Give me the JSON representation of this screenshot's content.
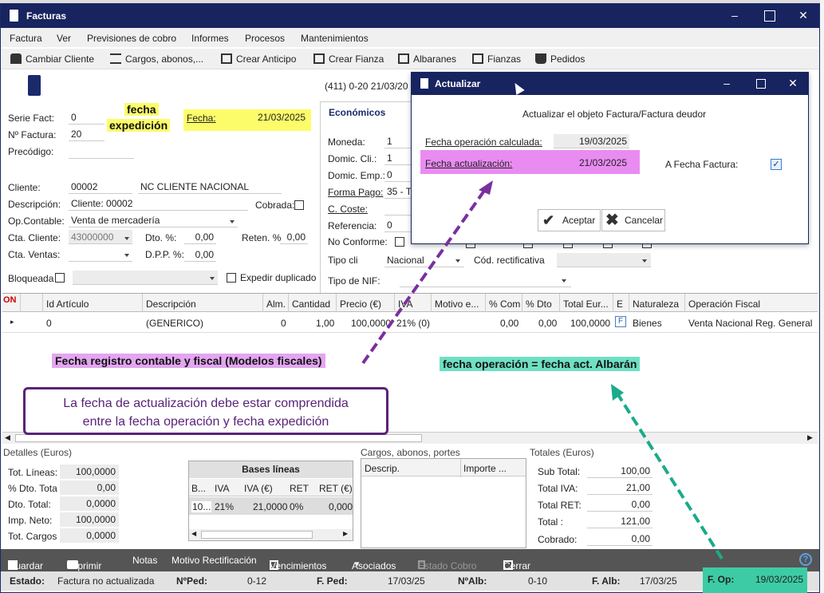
{
  "window": {
    "title": "Facturas"
  },
  "menu": [
    "Factura",
    "Ver",
    "Previsiones de cobro",
    "Informes",
    "Procesos",
    "Mantenimientos"
  ],
  "toolbar": {
    "cambiar_cliente": "Cambiar Cliente",
    "cargos": "Cargos, abonos,...",
    "crear_anticipo": "Crear Anticipo",
    "crear_fianza": "Crear Fianza",
    "albaranes": "Albaranes",
    "fianzas": "Fianzas",
    "pedidos": "Pedidos"
  },
  "header": {
    "account_info": "(411) 0-20  21/03/20"
  },
  "form": {
    "serie_label": "Serie Fact:",
    "serie_value": "0",
    "factura_label": "Nº Factura:",
    "factura_value": "20",
    "precodigo_label": "Precódigo:",
    "fecha_label": "Fecha:",
    "fecha_value": "21/03/2025",
    "cliente_label": "Cliente:",
    "cliente_code": "00002",
    "cliente_name": "NC CLIENTE NACIONAL",
    "descripcion_label": "Descripción:",
    "descripcion_value": "Cliente: 00002",
    "cobrada_label": "Cobrada:",
    "opcontable_label": "Op.Contable:",
    "opcontable_value": "Venta de mercadería",
    "ctacliente_label": "Cta. Cliente:",
    "ctacliente_value": "43000000",
    "dto_label": "Dto. %:",
    "dto_value": "0,00",
    "reten_label": "Reten. %",
    "reten_value": "0,00",
    "ctaventas_label": "Cta. Ventas:",
    "dpp_label": "D.P.P. %:",
    "dpp_value": "0,00",
    "bloqueada_label": "Bloqueada",
    "expedir_label": "Expedir duplicado"
  },
  "economicos": {
    "title": "Económicos",
    "moneda_label": "Moneda:",
    "moneda_value": "1",
    "domcli_label": "Domic. Cli.:",
    "domcli_value": "1",
    "domemp_label": "Domic. Emp.:",
    "domemp_value": "0",
    "formapago_label": "Forma Pago:",
    "formapago_value": "35 - T",
    "ccoste_label": "C. Coste:",
    "referencia_label": "Referencia:",
    "referencia_value": "0",
    "noconforme_label": "No Conforme:",
    "tipocli_label": "Tipo cli",
    "tipocli_value": "Nacional",
    "codrect_label": "Cód. rectificativa",
    "tiponif_label": "Tipo de NIF:"
  },
  "dialog": {
    "title": "Actualizar",
    "message": "Actualizar el objeto Factura/Factura deudor",
    "fecha_op_label": "Fecha operación calculada:",
    "fecha_op_value": "19/03/2025",
    "fecha_act_label": "Fecha actualización:",
    "fecha_act_value": "21/03/2025",
    "a_fecha_label": "A Fecha Factura:",
    "aceptar": "Aceptar",
    "cancelar": "Cancelar"
  },
  "callouts": {
    "fecha_expedicion_1": "fecha",
    "fecha_expedicion_2": "expedición",
    "registro": "Fecha registro contable y fiscal (Modelos fiscales)",
    "fecha_operacion": "fecha operación = fecha act. Albarán",
    "box_line1": "La fecha de actualización debe estar comprendida",
    "box_line2": "entre la fecha operación y fecha expedición"
  },
  "grid": {
    "on_label": "ON",
    "columns": [
      "Id Artículo",
      "Descripción",
      "Alm.",
      "Cantidad",
      "Precio (€)",
      "IVA",
      "Motivo e...",
      "% Com",
      "% Dto",
      "Total Eur...",
      "E",
      "Naturaleza",
      "Operación Fiscal"
    ],
    "row": {
      "id": "0",
      "desc": "(GENERICO)",
      "alm": "0",
      "cantidad": "1,00",
      "precio": "100,0000",
      "iva": "21% (0)",
      "com": "0,00",
      "dto": "0,00",
      "total": "100,0000",
      "e": "F",
      "naturaleza": "Bienes",
      "opfiscal": "Venta Nacional Reg. General"
    }
  },
  "detalles": {
    "title": "Detalles (Euros)",
    "totlineas_label": "Tot. Líneas:",
    "totlineas": "100,0000",
    "dtototal_pct_label": "% Dto. Tota",
    "dtototal_pct": "0,00",
    "dtototal_label": "Dto. Total:",
    "dtototal": "0,0000",
    "impneto_label": "Imp. Neto:",
    "impneto": "100,0000",
    "totcargos_label": "Tot. Cargos",
    "totcargos": "0,0000"
  },
  "bases": {
    "title": "Bases líneas",
    "cols": [
      "B...",
      "IVA",
      "IVA (€)",
      "RET",
      "RET (€)"
    ],
    "row": [
      "10...",
      "21%",
      "21,0000",
      "0%",
      "0,000"
    ]
  },
  "cargos": {
    "title": "Cargos, abonos, portes",
    "cols": [
      "Descrip.",
      "Importe ..."
    ]
  },
  "totales": {
    "title": "Totales (Euros)",
    "subtotal_label": "Sub Total:",
    "subtotal": "100,00",
    "totaliva_label": "Total IVA:",
    "totaliva": "21,00",
    "totalret_label": "Total RET:",
    "totalret": "0,00",
    "total_label": "Total :",
    "total": "121,00",
    "cobrado_label": "Cobrado:",
    "cobrado": "0,00"
  },
  "bottombar": {
    "guardar": "Guardar",
    "imprimir": "Imprimir",
    "notas": "Notas",
    "motivo": "Motivo Rectificación",
    "vencimientos": "Vencimientos",
    "asociados": "Asociados",
    "estado_cobro": "Estado Cobro",
    "cerrar": "Cerrar"
  },
  "status": {
    "estado_label": "Estado:",
    "estado": "Factura no actualizada",
    "nped_label": "NºPed:",
    "nped": "0-12",
    "fped_label": "F. Ped:",
    "fped": "17/03/25",
    "nalb_label": "NºAlb:",
    "nalb": "0-10",
    "falb_label": "F. Alb:",
    "falb": "17/03/25",
    "fop_label": "F. Op:",
    "fop": "19/03/2025"
  },
  "colors": {
    "titlebar": "#17245f",
    "purple": "#7b2f9e",
    "teal": "#1aab8a",
    "highlight_yellow": "#fcfc6b",
    "highlight_magenta": "#e98cf2",
    "highlight_teal": "#3dcba5"
  }
}
